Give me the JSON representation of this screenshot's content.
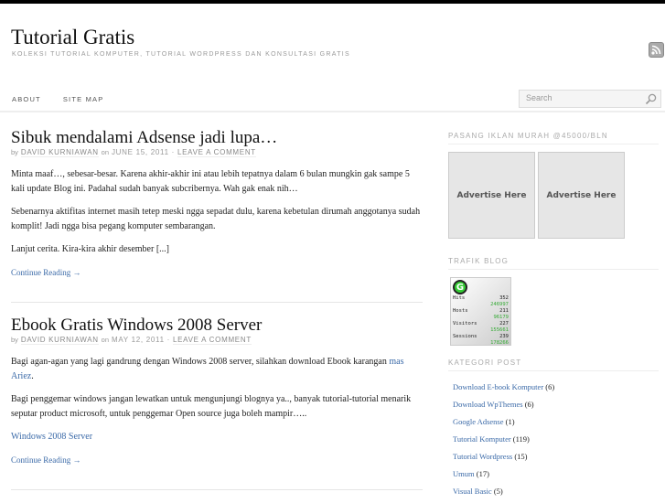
{
  "header": {
    "title": "Tutorial Gratis",
    "tagline": "KOLEKSI TUTORIAL KOMPUTER, TUTORIAL WORDPRESS DAN KONSULTASI GRATIS",
    "rss_icon": "rss-icon"
  },
  "nav": {
    "items": [
      {
        "label": "ABOUT"
      },
      {
        "label": "SITE MAP"
      }
    ]
  },
  "search": {
    "placeholder": "Search",
    "icon": "search-icon"
  },
  "posts": [
    {
      "title": "Sibuk mendalami Adsense jadi lupa…",
      "by": "by",
      "author": "DAVID KURNIAWAN",
      "on": "on",
      "date": "JUNE 15, 2011",
      "sep": "·",
      "comment": "LEAVE A COMMENT",
      "paragraphs": [
        "Minta maaf…, sebesar-besar. Karena akhir-akhir ini atau lebih tepatnya dalam 6 bulan mungkin gak sampe 5 kali update Blog ini. Padahal sudah banyak subcribernya. Wah gak enak nih…",
        "Sebenarnya aktifitas internet masih tetep meski ngga sepadat dulu, karena kebetulan dirumah anggotanya sudah komplit! Jadi ngga bisa pegang komputer sembarangan.",
        "Lanjut cerita. Kira-kira akhir desember [...]"
      ],
      "more": "Continue Reading →"
    },
    {
      "title": "Ebook Gratis Windows 2008 Server",
      "by": "by",
      "author": "DAVID KURNIAWAN",
      "on": "on",
      "date": "MAY 12, 2011",
      "sep": "·",
      "comment": "LEAVE A COMMENT",
      "p1": "Bagi agan-agan yang lagi gandrung dengan Windows 2008 server, silahkan download Ebook karangan ",
      "p1_link": "mas Ariez",
      "p2": "Bagi penggemar windows jangan lewatkan untuk mengunjungi blognya ya.., banyak tutorial-tutorial menarik seputar product microsoft, untuk penggemar Open source juga boleh mampir…..",
      "link": "Windows 2008 Server",
      "more": "Continue Reading →"
    }
  ],
  "sidebar": {
    "ads_title": "PASANG IKLAN MURAH @45000/BLN",
    "ads": [
      "Advertise Here",
      "Advertise Here"
    ],
    "traffic_title": "TRAFIK BLOG",
    "counter": [
      {
        "label": "Hits",
        "today": "352",
        "total": "246997"
      },
      {
        "label": "Hosts",
        "today": "211",
        "total": "96179"
      },
      {
        "label": "Visitors",
        "today": "227",
        "total": "155661"
      },
      {
        "label": "Sessions",
        "today": "239",
        "total": "178266"
      }
    ],
    "cat_title": "KATEGORI POST",
    "categories": [
      {
        "name": "Download E-book Komputer",
        "count": "(6)"
      },
      {
        "name": "Download WpThemes",
        "count": "(6)"
      },
      {
        "name": "Google Adsense",
        "count": "(1)"
      },
      {
        "name": "Tutorial Komputer",
        "count": "(119)"
      },
      {
        "name": "Tutorial Wordpress",
        "count": "(15)"
      },
      {
        "name": "Umum",
        "count": "(17)"
      },
      {
        "name": "Visual Basic",
        "count": "(5)"
      }
    ]
  }
}
